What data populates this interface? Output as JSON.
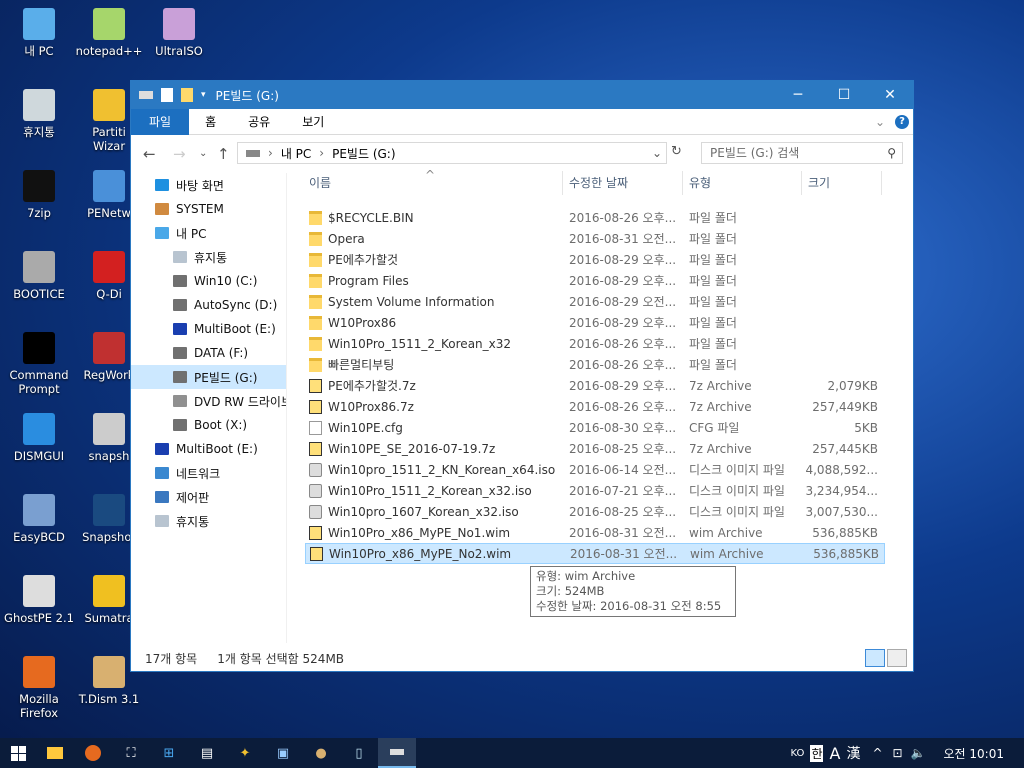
{
  "desktop": {
    "icons": [
      {
        "label": "내 PC",
        "col": 0,
        "row": 0,
        "color": "#5aaeea"
      },
      {
        "label": "notepad++",
        "col": 1,
        "row": 0,
        "color": "#a6d66b"
      },
      {
        "label": "UltraISO",
        "col": 2,
        "row": 0,
        "color": "#c9a0d8"
      },
      {
        "label": "휴지통",
        "col": 0,
        "row": 1,
        "color": "#cfd8dc"
      },
      {
        "label": "Partiti\nWizar",
        "col": 1,
        "row": 1,
        "color": "#f0c030"
      },
      {
        "label": "7zip",
        "col": 0,
        "row": 2,
        "color": "#111111"
      },
      {
        "label": "PENetw",
        "col": 1,
        "row": 2,
        "color": "#4a90d9"
      },
      {
        "label": "BOOTICE",
        "col": 0,
        "row": 3,
        "color": "#aaaaaa"
      },
      {
        "label": "Q-Di",
        "col": 1,
        "row": 3,
        "color": "#d32020"
      },
      {
        "label": "Command\nPrompt",
        "col": 0,
        "row": 4,
        "color": "#000000"
      },
      {
        "label": "RegWork",
        "col": 1,
        "row": 4,
        "color": "#c03030"
      },
      {
        "label": "DISMGUI",
        "col": 0,
        "row": 5,
        "color": "#2a8de0"
      },
      {
        "label": "snapsh",
        "col": 1,
        "row": 5,
        "color": "#cccccc"
      },
      {
        "label": "EasyBCD",
        "col": 0,
        "row": 6,
        "color": "#7a9fd0"
      },
      {
        "label": "Snapshot",
        "col": 1,
        "row": 6,
        "color": "#1a4a80"
      },
      {
        "label": "GhostPE 2.1",
        "col": 0,
        "row": 7,
        "color": "#dddddd"
      },
      {
        "label": "Sumatra",
        "col": 1,
        "row": 7,
        "color": "#f0c020"
      },
      {
        "label": "Mozilla\nFirefox",
        "col": 0,
        "row": 8,
        "color": "#e66a1f"
      },
      {
        "label": "T.Dism 3.1",
        "col": 1,
        "row": 8,
        "color": "#d8b070"
      }
    ]
  },
  "window": {
    "title": "PE빌드 (G:)",
    "minimize": "─",
    "maximize": "☐",
    "close": "✕",
    "ribbon_tabs": [
      "파일",
      "홈",
      "공유",
      "보기"
    ],
    "address": {
      "crumbs": [
        "내 PC",
        "PE빌드 (G:)"
      ],
      "search_placeholder": "PE빌드 (G:) 검색"
    },
    "nav": [
      {
        "label": "바탕 화면",
        "indent": 0,
        "color": "#1e90e0"
      },
      {
        "label": "SYSTEM",
        "indent": 0,
        "color": "#d08a40"
      },
      {
        "label": "내 PC",
        "indent": 0,
        "color": "#4aa8e8"
      },
      {
        "label": "휴지통",
        "indent": 1,
        "color": "#b8c4d0"
      },
      {
        "label": "Win10 (C:)",
        "indent": 1,
        "color": "#707070"
      },
      {
        "label": "AutoSync (D:)",
        "indent": 1,
        "color": "#707070"
      },
      {
        "label": "MultiBoot (E:)",
        "indent": 1,
        "color": "#1a3fb0"
      },
      {
        "label": "DATA (F:)",
        "indent": 1,
        "color": "#707070"
      },
      {
        "label": "PE빌드 (G:)",
        "indent": 1,
        "color": "#707070",
        "selected": true
      },
      {
        "label": "DVD RW 드라이브",
        "indent": 1,
        "color": "#909090"
      },
      {
        "label": "Boot (X:)",
        "indent": 1,
        "color": "#707070"
      },
      {
        "label": "MultiBoot (E:)",
        "indent": 0,
        "color": "#1a3fb0"
      },
      {
        "label": "네트워크",
        "indent": 0,
        "color": "#3a88d0"
      },
      {
        "label": "제어판",
        "indent": 0,
        "color": "#3a78c0"
      },
      {
        "label": "휴지통",
        "indent": 0,
        "color": "#b8c4d0"
      }
    ],
    "columns": [
      "이름",
      "수정한 날짜",
      "유형",
      "크기"
    ],
    "files": [
      {
        "name": "$RECYCLE.BIN",
        "date": "2016-08-26 오후...",
        "type": "파일 폴더",
        "size": "",
        "icon": "folder"
      },
      {
        "name": "Opera",
        "date": "2016-08-31 오전...",
        "type": "파일 폴더",
        "size": "",
        "icon": "folder"
      },
      {
        "name": "PE에추가할것",
        "date": "2016-08-29 오후...",
        "type": "파일 폴더",
        "size": "",
        "icon": "folder"
      },
      {
        "name": "Program Files",
        "date": "2016-08-29 오후...",
        "type": "파일 폴더",
        "size": "",
        "icon": "folder"
      },
      {
        "name": "System Volume Information",
        "date": "2016-08-29 오전...",
        "type": "파일 폴더",
        "size": "",
        "icon": "folder"
      },
      {
        "name": "W10Prox86",
        "date": "2016-08-29 오후...",
        "type": "파일 폴더",
        "size": "",
        "icon": "folder"
      },
      {
        "name": "Win10Pro_1511_2_Korean_x32",
        "date": "2016-08-26 오후...",
        "type": "파일 폴더",
        "size": "",
        "icon": "folder"
      },
      {
        "name": "빠른멀티부팅",
        "date": "2016-08-26 오후...",
        "type": "파일 폴더",
        "size": "",
        "icon": "folder"
      },
      {
        "name": "PE에추가할것.7z",
        "date": "2016-08-29 오후...",
        "type": "7z Archive",
        "size": "2,079KB",
        "icon": "sevenz"
      },
      {
        "name": "W10Prox86.7z",
        "date": "2016-08-26 오후...",
        "type": "7z Archive",
        "size": "257,449KB",
        "icon": "sevenz"
      },
      {
        "name": "Win10PE.cfg",
        "date": "2016-08-30 오후...",
        "type": "CFG 파일",
        "size": "5KB",
        "icon": "doc"
      },
      {
        "name": "Win10PE_SE_2016-07-19.7z",
        "date": "2016-08-25 오후...",
        "type": "7z Archive",
        "size": "257,445KB",
        "icon": "sevenz"
      },
      {
        "name": "Win10pro_1511_2_KN_Korean_x64.iso",
        "date": "2016-06-14 오전...",
        "type": "디스크 이미지 파일",
        "size": "4,088,592...",
        "icon": "iso"
      },
      {
        "name": "Win10Pro_1511_2_Korean_x32.iso",
        "date": "2016-07-21 오후...",
        "type": "디스크 이미지 파일",
        "size": "3,234,954...",
        "icon": "iso"
      },
      {
        "name": "Win10pro_1607_Korean_x32.iso",
        "date": "2016-08-25 오후...",
        "type": "디스크 이미지 파일",
        "size": "3,007,530...",
        "icon": "iso"
      },
      {
        "name": "Win10Pro_x86_MyPE_No1.wim",
        "date": "2016-08-31 오전...",
        "type": "wim Archive",
        "size": "536,885KB",
        "icon": "sevenz"
      },
      {
        "name": "Win10Pro_x86_MyPE_No2.wim",
        "date": "2016-08-31 오전...",
        "type": "wim Archive",
        "size": "536,885KB",
        "icon": "sevenz",
        "selected": true
      }
    ],
    "tooltip": [
      "유형: wim Archive",
      "크기: 524MB",
      "수정한 날짜: 2016-08-31 오전 8:55"
    ],
    "status": {
      "count": "17개 항목",
      "selection": "1개 항목 선택함 524MB"
    }
  },
  "taskbar": {
    "lang": "KO",
    "ime1": "한",
    "ime2": "A",
    "ime3": "漢",
    "clock": "오전 10:01"
  }
}
